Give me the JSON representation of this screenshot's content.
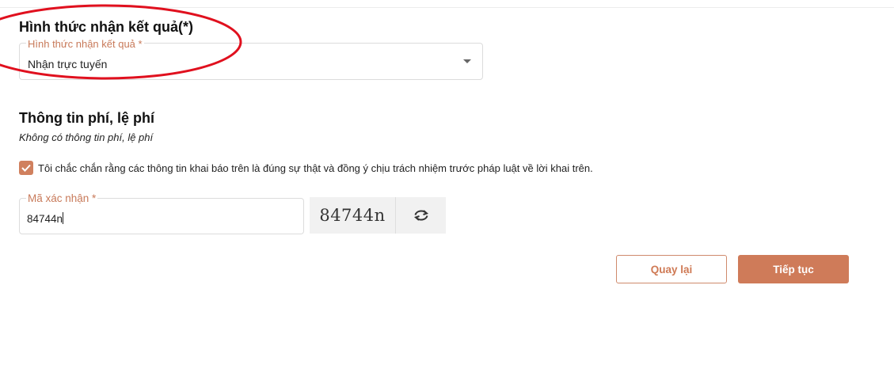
{
  "receive_section": {
    "title": "Hình thức nhận kết quả(*)",
    "select_label": "Hình thức nhận kết quả *",
    "select_value": "Nhận trực tuyến"
  },
  "fee_section": {
    "title": "Thông tin phí, lệ phí",
    "note": "Không có thông tin phí, lệ phí"
  },
  "agreement": {
    "checked": true,
    "text": "Tôi chắc chắn rằng các thông tin khai báo trên là đúng sự thật và đồng ý chịu trách nhiệm trước pháp luật về lời khai trên."
  },
  "captcha": {
    "label": "Mã xác nhận *",
    "value": "84744n",
    "image_text": "84744n",
    "refresh_icon": "refresh-icon"
  },
  "actions": {
    "back_label": "Quay lại",
    "next_label": "Tiếp tục"
  },
  "colors": {
    "accent": "#cf7b59",
    "annotation": "#e0101e"
  }
}
